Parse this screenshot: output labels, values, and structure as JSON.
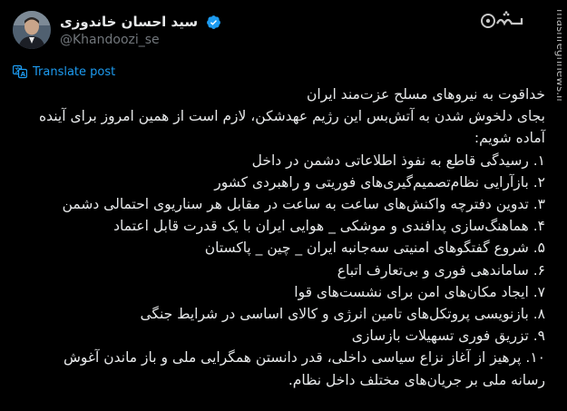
{
  "header": {
    "display_name": "سید احسان خاندوزی",
    "handle": "@Khandoozi_se",
    "verified": true
  },
  "watermark": {
    "logo": "مشرق",
    "side_text": "mashreghnews.ir"
  },
  "translate_label": "Translate post",
  "tweet": {
    "lines": [
      "خداقوت به نیروهای مسلح عزت‌مند ایران",
      "بجای دلخوش شدن به آتش‌بس این رژیم عهدشکن، لازم است از همین امروز برای آینده",
      "آماده شویم:",
      "۱. رسیدگی قاطع به نفوذ اطلاعاتی دشمن در داخل",
      "۲. بازآرایی نظام‌تصمیم‌گیری‌های فوریتی و راهبردی کشور",
      "۳. تدوین دفترچه واکنش‌های ساعت به ساعت در مقابل هر سناریوی احتمالی دشمن",
      "۴. هماهنگ‌سازی پدافندی و موشکی _ هوایی ایران با یک قدرت قابل اعتماد",
      "۵. شروع گفتگوهای امنیتی سه‌جانبه ایران _ چین _ پاکستان",
      "۶. ساماندهی فوری و بی‌تعارف اتباع",
      "۷. ایجاد مکان‌های امن برای نشست‌های قوا",
      "۸. بازنویسی پروتکل‌های تامین انرژی و کالای اساسی در شرایط جنگی",
      "۹. تزریق فوری تسهیلات بازسازی",
      "۱۰. پرهیز از آغاز نزاع سیاسی داخلی، قدر دانستن همگرایی ملی و باز ماندن آغوش",
      "رسانه ملی بر جریان‌های مختلف داخل نظام."
    ]
  },
  "colors": {
    "background": "#000000",
    "text": "#e7e9ea",
    "secondary": "#71767b",
    "accent": "#1d9bf0"
  },
  "icons": [
    "avatar",
    "verified-badge-icon",
    "translate-icon",
    "mashregh-logo"
  ]
}
